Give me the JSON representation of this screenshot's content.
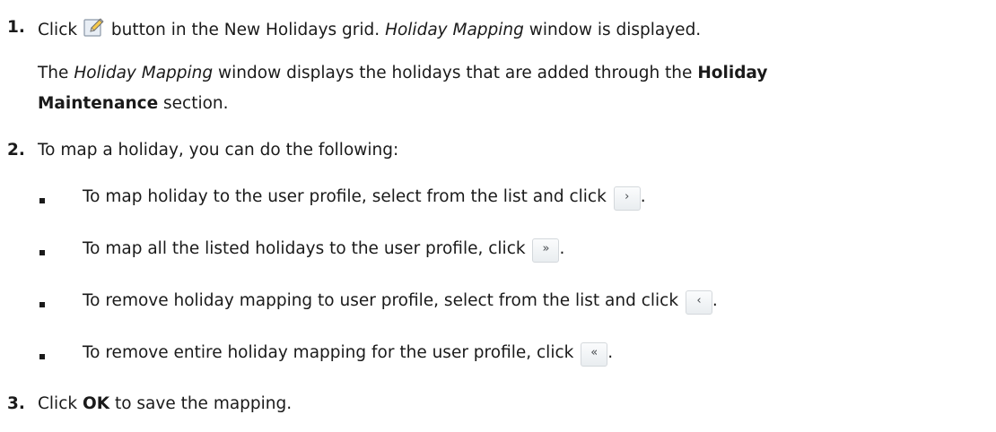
{
  "steps": [
    {
      "number": "1.",
      "text_a": "Click",
      "icon": "edit-icon",
      "text_b": "button in the New Holidays grid.",
      "italic": "Holiday Mapping",
      "text_c": "window is displayed.",
      "para": {
        "pre": "The",
        "italic": "Holiday Mapping",
        "mid": "window displays the holidays that are added through the",
        "bold_1": "Holiday",
        "bold_2": "Maintenance",
        "post": "section."
      }
    },
    {
      "number": "2.",
      "text": "To map a holiday, you can do the following:",
      "bullets": [
        {
          "text": "To map holiday to the user profile, select from the list and click",
          "button": "›",
          "end": "."
        },
        {
          "text": "To map all the listed holidays to the user profile, click",
          "button": "»",
          "end": "."
        },
        {
          "text": "To remove holiday mapping to user profile, select from the list and click",
          "button": "‹",
          "end": "."
        },
        {
          "text": "To remove entire holiday mapping for the user profile, click",
          "button": "«",
          "end": "."
        }
      ]
    },
    {
      "number": "3.",
      "pre": "Click",
      "bold": "OK",
      "post": "to save the mapping."
    }
  ]
}
